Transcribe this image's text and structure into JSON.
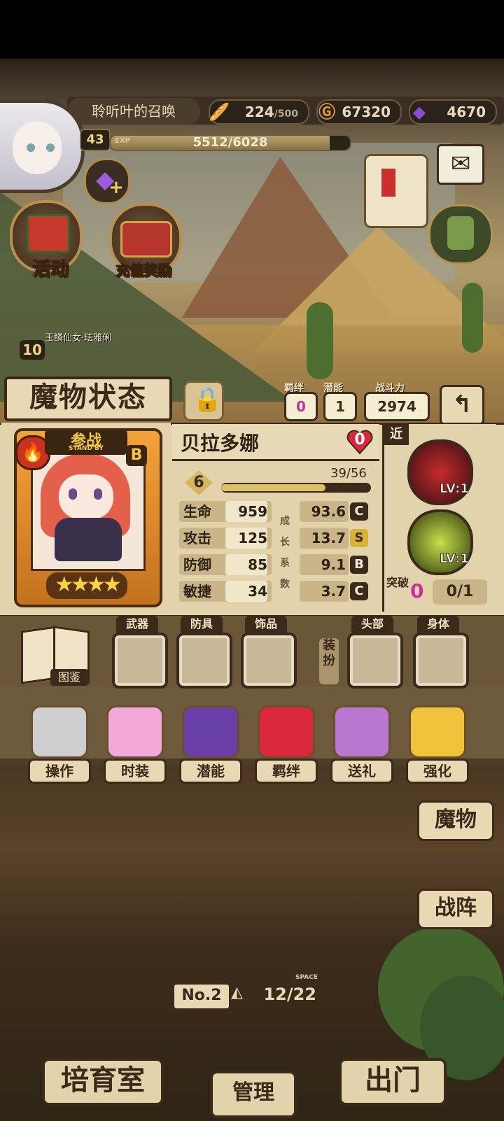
{
  "player": {
    "summon_title": "聆听叶的召唤",
    "level": "43",
    "exp_label": "EXP",
    "exp": "5512/6028",
    "exp_fraction": 0.914
  },
  "resources": {
    "bread": {
      "value": "224",
      "max": "/500"
    },
    "gold": "67320",
    "gems": "4670"
  },
  "menu": {
    "activity": "活动",
    "recharge": "充值奖励"
  },
  "pet_preview": {
    "name": "玉鳞仙女·珐雅俐",
    "level": "10"
  },
  "monster": {
    "panel_title": "魔物状态",
    "bond_label": "羁绊",
    "bond": "0",
    "potential_label": "潜能",
    "potential": "1",
    "power_label": "战斗力",
    "power": "2974",
    "name": "贝拉多娜",
    "heart": "0",
    "standby_cn": "参战",
    "standby_en": "STAND BY",
    "rank": "B",
    "stars": "★★★★",
    "level": "6",
    "progress": "39/56",
    "progress_fraction": 0.696,
    "growth_vertical": [
      "成",
      "长",
      "系",
      "数"
    ],
    "stats": [
      {
        "label": "生命",
        "value": "959",
        "growth": "93.6",
        "grade": "C"
      },
      {
        "label": "攻击",
        "value": "125",
        "growth": "13.7",
        "grade": "S"
      },
      {
        "label": "防御",
        "value": "85",
        "growth": "9.1",
        "grade": "B"
      },
      {
        "label": "敏捷",
        "value": "34",
        "growth": "3.7",
        "grade": "C"
      }
    ],
    "range": "近",
    "skill_levels": [
      "LV:1",
      "LV:1"
    ],
    "breakthrough_label": "突破",
    "breakthrough": "0",
    "breakthrough_progress": "0/1"
  },
  "equipment": {
    "codex": "图鉴",
    "weapon": "武器",
    "armor": "防具",
    "accessory": "饰品",
    "equip": "装扮",
    "head": "头部",
    "body": "身体"
  },
  "actions": [
    "操作",
    "时装",
    "潜能",
    "羁绊",
    "送礼",
    "强化"
  ],
  "side": {
    "monsters": "魔物",
    "formation": "战阵"
  },
  "storage": {
    "number": "No.2",
    "space_label": "SPACE",
    "capacity": "12/22"
  },
  "bottom_nav": {
    "nursery": "培育室",
    "manage": "管理",
    "exit": "出门"
  },
  "colors": {
    "panel": "#e3d3ad",
    "outline": "#3b2a19",
    "grade_s": "#d7b23a",
    "pink": "#c7339a"
  }
}
